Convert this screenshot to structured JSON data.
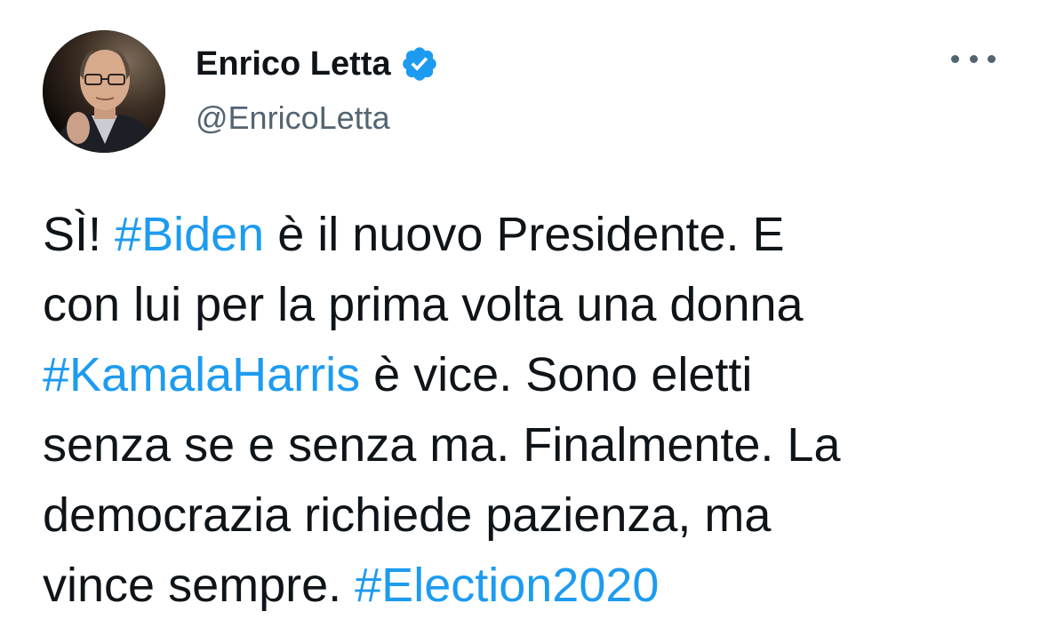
{
  "author": {
    "display_name": "Enrico Letta",
    "handle": "@EnricoLetta",
    "verified": true,
    "avatar_icon": "profile-photo"
  },
  "menu": {
    "icon": "more-horizontal-icon"
  },
  "colors": {
    "hashtag": "#1d9bf0",
    "verified_badge": "#1d9bf0",
    "text": "#0f1419",
    "secondary_text": "#536471"
  },
  "tweet": {
    "lines": [
      [
        {
          "text": "SÌ! "
        },
        {
          "text": "#Biden",
          "hashtag": true
        },
        {
          "text": " è il nuovo Presidente. E"
        }
      ],
      [
        {
          "text": "con lui per la prima volta una donna"
        }
      ],
      [
        {
          "text": "#KamalaHarris",
          "hashtag": true
        },
        {
          "text": " è vice. Sono eletti"
        }
      ],
      [
        {
          "text": "senza se e senza ma. Finalmente. La"
        }
      ],
      [
        {
          "text": "democrazia richiede pazienza, ma"
        }
      ],
      [
        {
          "text": "vince sempre. "
        },
        {
          "text": "#Election2020",
          "hashtag": true
        }
      ]
    ]
  }
}
